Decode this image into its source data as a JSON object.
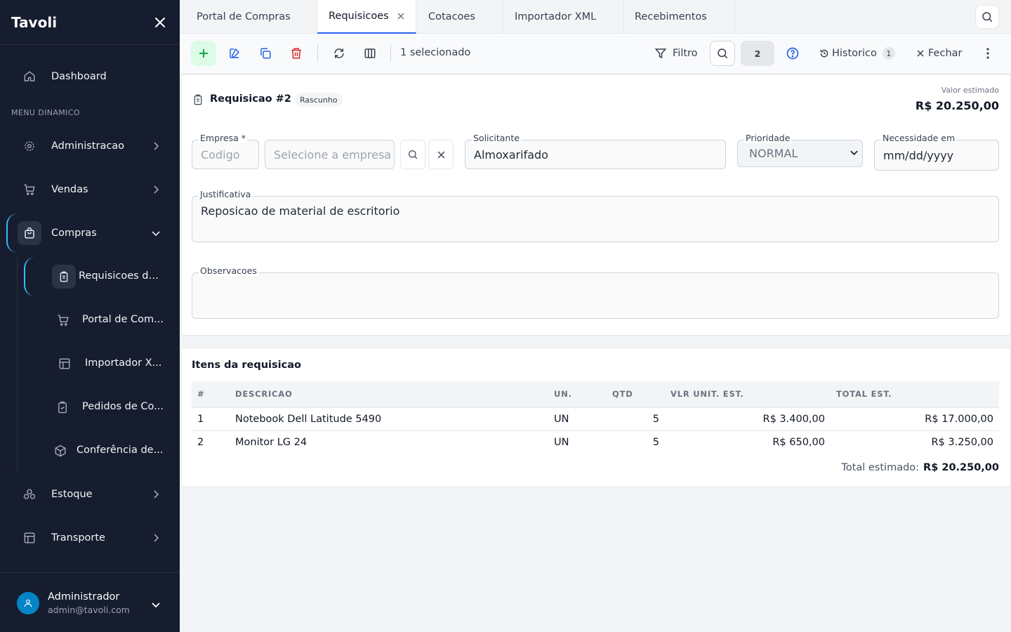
{
  "sidebar": {
    "brand": "Tavoli",
    "section_label": "MENU DINAMICO",
    "dashboard": "Dashboard",
    "administracao": "Administracao",
    "vendas": "Vendas",
    "compras": "Compras",
    "sub_items": [
      "Requisicoes de...",
      "Portal de Com...",
      "Importador X...",
      "Pedidos de Co...",
      "Conferência de..."
    ],
    "estoque": "Estoque",
    "transporte": "Transporte",
    "user": {
      "name": "Administrador",
      "email": "admin@tavoli.com"
    }
  },
  "tabs": [
    "Portal de Compras",
    "Requisicoes",
    "Cotacoes",
    "Importador XML",
    "Recebimentos"
  ],
  "toolbar": {
    "selected_text": "1 selecionado",
    "filter_label": "Filtro",
    "page_number": "2",
    "history_label": "Historico",
    "history_count": "1",
    "close_label": "Fechar"
  },
  "form": {
    "title": "Requisicao #2",
    "status_badge": "Rascunho",
    "estimated_label": "Valor estimado",
    "estimated_value": "R$ 20.250,00",
    "empresa_label": "Empresa *",
    "empresa_code_placeholder": "Codigo",
    "empresa_select_placeholder": "Selecione a empresa",
    "solicitante_label": "Solicitante",
    "solicitante_value": "Almoxarifado",
    "prioridade_label": "Prioridade",
    "prioridade_value": "NORMAL",
    "necessidade_label": "Necessidade em",
    "necessidade_placeholder": "mm/dd/yyyy",
    "justificativa_label": "Justificativa",
    "justificativa_value": "Reposicao de material de escritorio",
    "observacoes_label": "Observacoes",
    "observacoes_value": ""
  },
  "items": {
    "title": "Itens da requisicao",
    "columns": [
      "#",
      "DESCRICAO",
      "UN.",
      "QTD",
      "VLR UNIT. EST.",
      "TOTAL EST."
    ],
    "rows": [
      [
        "1",
        "Notebook Dell Latitude 5490",
        "UN",
        "5",
        "R$ 3.400,00",
        "R$ 17.000,00"
      ],
      [
        "2",
        "Monitor LG 24",
        "UN",
        "5",
        "R$ 650,00",
        "R$ 3.250,00"
      ]
    ],
    "total_label": "Total estimado:",
    "total_value": "R$ 20.250,00"
  },
  "colors": {
    "sidebar_bg": "#161d2e",
    "accent": "#2563eb",
    "active_bracket": "#38bdf8",
    "add_green": "#16a34a",
    "delete_red": "#dc2626"
  }
}
